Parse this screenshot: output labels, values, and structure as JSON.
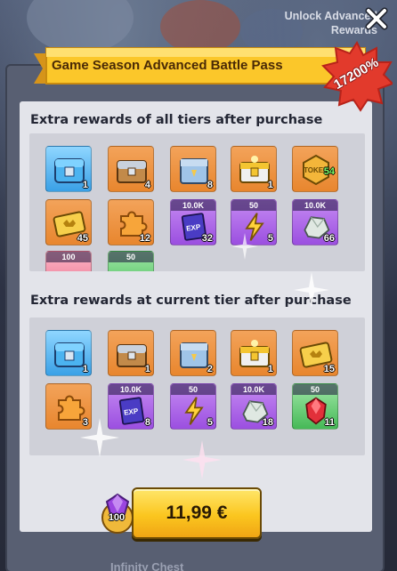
{
  "header": {
    "unlock_label": "Unlock Advanced Rewards",
    "close_icon": "close-icon"
  },
  "banner": {
    "title": "Game Season Advanced Battle Pass",
    "value_badge": "17200%"
  },
  "section_all": {
    "title": "Extra rewards of all tiers after purchase",
    "items": [
      {
        "icon": "blue-chest-icon",
        "color": "blue",
        "count": "1"
      },
      {
        "icon": "silver-chest-icon",
        "color": "orange",
        "count": "4"
      },
      {
        "icon": "steel-chest-icon",
        "color": "orange",
        "count": "8"
      },
      {
        "icon": "golden-chest-icon",
        "color": "orange",
        "count": "1"
      },
      {
        "icon": "coin-token-icon",
        "color": "orange",
        "count": "",
        "badge": "54"
      },
      {
        "icon": "gold-ticket-icon",
        "color": "orange",
        "count": "45"
      },
      {
        "icon": "puzzle-piece-icon",
        "color": "orange",
        "count": "12"
      },
      {
        "icon": "exp-book-icon",
        "color": "purple",
        "count": "32",
        "top": "10.0K"
      },
      {
        "icon": "lightning-icon",
        "color": "purple",
        "count": "5",
        "top": "50"
      },
      {
        "icon": "silver-ore-icon",
        "color": "purple",
        "count": "66",
        "top": "10.0K"
      },
      {
        "icon": "gift-icon",
        "color": "pink",
        "count": "",
        "top": "100"
      },
      {
        "icon": "green-item-icon",
        "color": "green",
        "count": "",
        "top": "50"
      }
    ]
  },
  "section_current": {
    "title": "Extra rewards at current tier after purchase",
    "items": [
      {
        "icon": "blue-chest-icon",
        "color": "blue",
        "count": "1"
      },
      {
        "icon": "silver-chest-icon",
        "color": "orange",
        "count": "1"
      },
      {
        "icon": "steel-chest-icon",
        "color": "orange",
        "count": "2"
      },
      {
        "icon": "golden-chest-icon",
        "color": "orange",
        "count": "1"
      },
      {
        "icon": "gold-ticket-icon",
        "color": "orange",
        "count": "15"
      },
      {
        "icon": "puzzle-piece-icon",
        "color": "orange",
        "count": "3"
      },
      {
        "icon": "exp-book-icon",
        "color": "purple",
        "count": "8",
        "top": "10.0K"
      },
      {
        "icon": "lightning-icon",
        "color": "purple",
        "count": "5",
        "top": "50"
      },
      {
        "icon": "silver-ore-icon",
        "color": "purple",
        "count": "18",
        "top": "10.0K"
      },
      {
        "icon": "red-gem-icon",
        "color": "green",
        "count": "11",
        "top": "50"
      }
    ]
  },
  "purchase": {
    "gem_bonus": "100",
    "price": "11,99 €"
  },
  "footer": {
    "hint": "Infinity Chest"
  },
  "colors": {
    "panel": "#585f72",
    "inner": "#e3e4ea",
    "banner": "#fbc72a",
    "burst": "#e23a2c",
    "button": "#fbc61f"
  }
}
